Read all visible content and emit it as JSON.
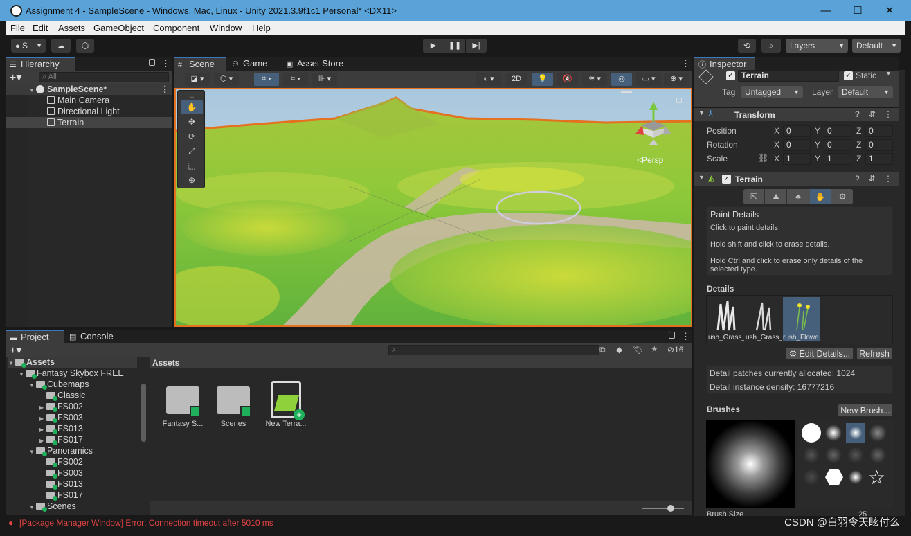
{
  "window": {
    "title": "Assignment 4 - SampleScene - Windows, Mac, Linux - Unity 2021.3.9f1c1 Personal* <DX11>"
  },
  "menu": [
    "File",
    "Edit",
    "Assets",
    "GameObject",
    "Component",
    "Window",
    "Help"
  ],
  "toolbar": {
    "account": "S",
    "layers": "Layers",
    "layout": "Default"
  },
  "hierarchy": {
    "tab": "Hierarchy",
    "search_placeholder": "All",
    "scene": "SampleScene*",
    "items": [
      "Main Camera",
      "Directional Light",
      "Terrain"
    ]
  },
  "scene_tabs": [
    "Scene",
    "Game",
    "Asset Store"
  ],
  "scene": {
    "toggle_2d": "2D",
    "persp_label": "<Persp"
  },
  "project": {
    "tabs": [
      "Project",
      "Console"
    ],
    "hidden_count": "16",
    "breadcrumb": "Assets",
    "tree": [
      {
        "label": "Assets",
        "depth": 0,
        "arrow": "▼"
      },
      {
        "label": "Fantasy Skybox FREE",
        "depth": 1,
        "arrow": "▼"
      },
      {
        "label": "Cubemaps",
        "depth": 2,
        "arrow": "▼"
      },
      {
        "label": "Classic",
        "depth": 3,
        "arrow": ""
      },
      {
        "label": "FS002",
        "depth": 3,
        "arrow": "▶"
      },
      {
        "label": "FS003",
        "depth": 3,
        "arrow": "▶"
      },
      {
        "label": "FS013",
        "depth": 3,
        "arrow": "▶"
      },
      {
        "label": "FS017",
        "depth": 3,
        "arrow": "▶"
      },
      {
        "label": "Panoramics",
        "depth": 2,
        "arrow": "▼"
      },
      {
        "label": "FS002",
        "depth": 3,
        "arrow": ""
      },
      {
        "label": "FS003",
        "depth": 3,
        "arrow": ""
      },
      {
        "label": "FS013",
        "depth": 3,
        "arrow": ""
      },
      {
        "label": "FS017",
        "depth": 3,
        "arrow": ""
      },
      {
        "label": "Scenes",
        "depth": 2,
        "arrow": "▼"
      }
    ],
    "assets": [
      "Fantasy S...",
      "Scenes",
      "New Terra..."
    ]
  },
  "inspector": {
    "tab": "Inspector",
    "object_name": "Terrain",
    "static_label": "Static",
    "tag_label": "Tag",
    "tag_value": "Untagged",
    "layer_label": "Layer",
    "layer_value": "Default",
    "transform": {
      "title": "Transform",
      "position": {
        "label": "Position",
        "x": "0",
        "y": "0",
        "z": "0"
      },
      "rotation": {
        "label": "Rotation",
        "x": "0",
        "y": "0",
        "z": "0"
      },
      "scale": {
        "label": "Scale",
        "x": "1",
        "y": "1",
        "z": "1"
      }
    },
    "terrain": {
      "title": "Terrain",
      "paint_title": "Paint Details",
      "help1": "Click to paint details.",
      "help2": "Hold shift and click to erase details.",
      "help3": "Hold Ctrl and click to erase only details of the selected type.",
      "details_label": "Details",
      "details": [
        "ush_Grass_",
        "ush_Grass_",
        "rush_Flowe"
      ],
      "edit_details": "Edit Details...",
      "refresh": "Refresh",
      "patches": "Detail patches currently allocated: 1024",
      "density": "Detail instance density: 16777216",
      "brushes_label": "Brushes",
      "new_brush": "New Brush...",
      "brush_size_label": "Brush Size",
      "brush_size_value": "25"
    }
  },
  "status": {
    "message": "[Package Manager Window] Error: Connection timeout after 5010 ms"
  },
  "watermark": "CSDN @白羽令天眩付么",
  "colors": {
    "accent": "#3a79bb",
    "selection": "#e4711f",
    "error": "#e04343",
    "titlebar": "#5aa3d8"
  }
}
